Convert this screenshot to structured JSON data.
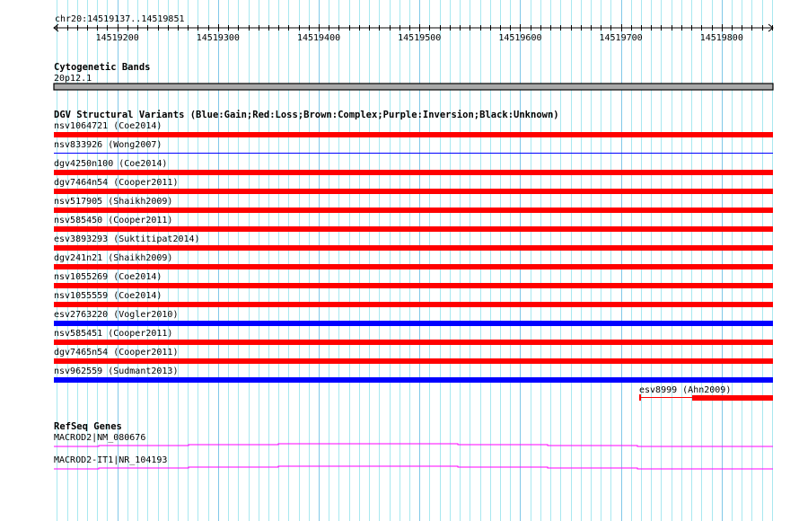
{
  "view": {
    "location": "chr20:14519137..14519851",
    "start": 14519137,
    "end": 14519851,
    "tick_labels": [
      "14519200",
      "14519300",
      "14519400",
      "14519500",
      "14519600",
      "14519700",
      "14519800"
    ]
  },
  "colors": {
    "gain": "#0000ff",
    "loss": "#ff0000",
    "gene": "#ff00ff",
    "grid_minor": "#a8e8f0",
    "grid_major": "#80c8e8",
    "band": "#a8a8a8"
  },
  "cytoband": {
    "title": "Cytogenetic Bands",
    "band_label": "20p12.1"
  },
  "dgv": {
    "title": "DGV Structural Variants (Blue:Gain;Red:Loss;Brown:Complex;Purple:Inversion;Black:Unknown)",
    "variants": [
      {
        "label": "nsv1064721 (Coe2014)",
        "type": "loss",
        "style": "thick"
      },
      {
        "label": "nsv833926 (Wong2007)",
        "type": "gain",
        "style": "thin"
      },
      {
        "label": "dgv4250n100 (Coe2014)",
        "type": "loss",
        "style": "thick"
      },
      {
        "label": "dgv7464n54 (Cooper2011)",
        "type": "loss",
        "style": "thick"
      },
      {
        "label": "nsv517905 (Shaikh2009)",
        "type": "loss",
        "style": "thick"
      },
      {
        "label": "nsv585450 (Cooper2011)",
        "type": "loss",
        "style": "thick"
      },
      {
        "label": "esv3893293 (Suktitipat2014)",
        "type": "loss",
        "style": "thick"
      },
      {
        "label": "dgv241n21 (Shaikh2009)",
        "type": "loss",
        "style": "thick"
      },
      {
        "label": "nsv1055269 (Coe2014)",
        "type": "loss",
        "style": "thick"
      },
      {
        "label": "nsv1055559 (Coe2014)",
        "type": "loss",
        "style": "thick"
      },
      {
        "label": "esv2763220 (Vogler2010)",
        "type": "gain",
        "style": "thick"
      },
      {
        "label": "nsv585451 (Cooper2011)",
        "type": "loss",
        "style": "thick"
      },
      {
        "label": "dgv7465n54 (Cooper2011)",
        "type": "loss",
        "style": "thick"
      },
      {
        "label": "nsv962559 (Sudmant2013)",
        "type": "gain",
        "style": "thick"
      }
    ],
    "partial": {
      "label": "esv8999 (Ahn2009)",
      "type": "loss",
      "thin_start": 14519718,
      "thick_start": 14519771
    }
  },
  "refseq": {
    "title": "RefSeq Genes",
    "genes": [
      {
        "label": "MACROD2|NM_080676"
      },
      {
        "label": "MACROD2-IT1|NR_104193"
      }
    ]
  }
}
